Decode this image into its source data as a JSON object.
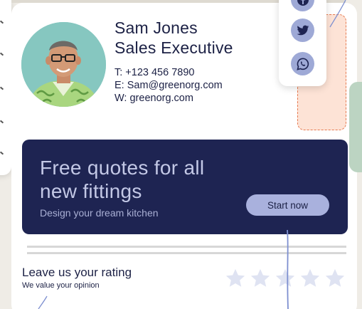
{
  "profile": {
    "name": "Sam Jones",
    "role": "Sales Executive",
    "phone": "T: +123 456 7890",
    "email": "E: Sam@greenorg.com",
    "website": "W: greenorg.com"
  },
  "social": {
    "icons": [
      "facebook-icon",
      "twitter-icon",
      "whatsapp-icon"
    ],
    "accent": "#9ea9d6"
  },
  "banner": {
    "title": "Free quotes for all new fittings",
    "subtitle": "Design your dream kitchen",
    "button_label": "Start now",
    "background": "#1e2452"
  },
  "rating": {
    "title": "Leave us your rating",
    "subtitle": "We value your opinion",
    "max_stars": 5,
    "star_color": "#dfe3f2"
  }
}
